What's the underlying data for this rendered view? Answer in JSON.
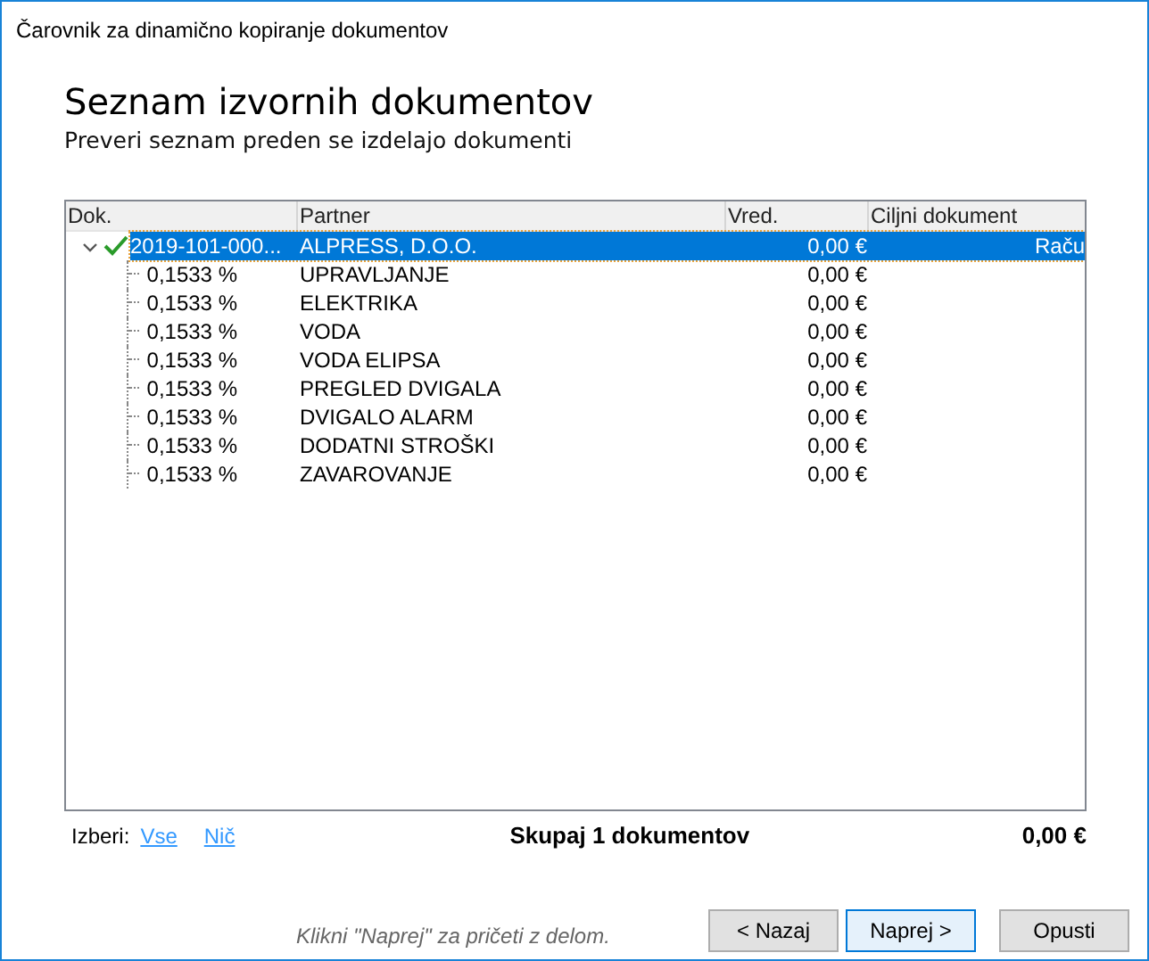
{
  "window": {
    "title": "Čarovnik za dinamično kopiranje dokumentov"
  },
  "heading": "Seznam izvornih dokumentov",
  "subtitle": "Preveri seznam preden se izdelajo dokumenti",
  "table": {
    "columns": [
      "Dok.",
      "Partner",
      "Vred.",
      "Ciljni dokument"
    ],
    "rows": [
      {
        "dok": "2019-101-000...",
        "partner": "ALPRESS, D.O.O.",
        "value": "0,00 €",
        "target": "Raču",
        "selected": true,
        "checked": true,
        "expanded": true,
        "children": [
          {
            "dok": "0,1533 %",
            "partner": "UPRAVLJANJE",
            "value": "0,00 €"
          },
          {
            "dok": "0,1533 %",
            "partner": "ELEKTRIKA",
            "value": "0,00 €"
          },
          {
            "dok": "0,1533 %",
            "partner": "VODA",
            "value": "0,00 €"
          },
          {
            "dok": "0,1533 %",
            "partner": "VODA ELIPSA",
            "value": "0,00 €"
          },
          {
            "dok": "0,1533 %",
            "partner": "PREGLED DVIGALA",
            "value": "0,00 €"
          },
          {
            "dok": "0,1533 %",
            "partner": "DVIGALO ALARM",
            "value": "0,00 €"
          },
          {
            "dok": "0,1533 %",
            "partner": "DODATNI STROŠKI",
            "value": "0,00 €"
          },
          {
            "dok": "0,1533 %",
            "partner": "ZAVAROVANJE",
            "value": "0,00 €"
          }
        ]
      }
    ]
  },
  "select": {
    "label": "Izberi:",
    "links": [
      "Vse",
      "Nič"
    ]
  },
  "total": {
    "label": "Skupaj 1 dokumentov",
    "value": "0,00 €"
  },
  "hint": "Klikni \"Naprej\" za pričeti z delom.",
  "buttons": [
    {
      "label": "< Nazaj",
      "default": false
    },
    {
      "label": "Naprej >",
      "default": true
    },
    {
      "label": "Opusti",
      "default": false
    }
  ]
}
